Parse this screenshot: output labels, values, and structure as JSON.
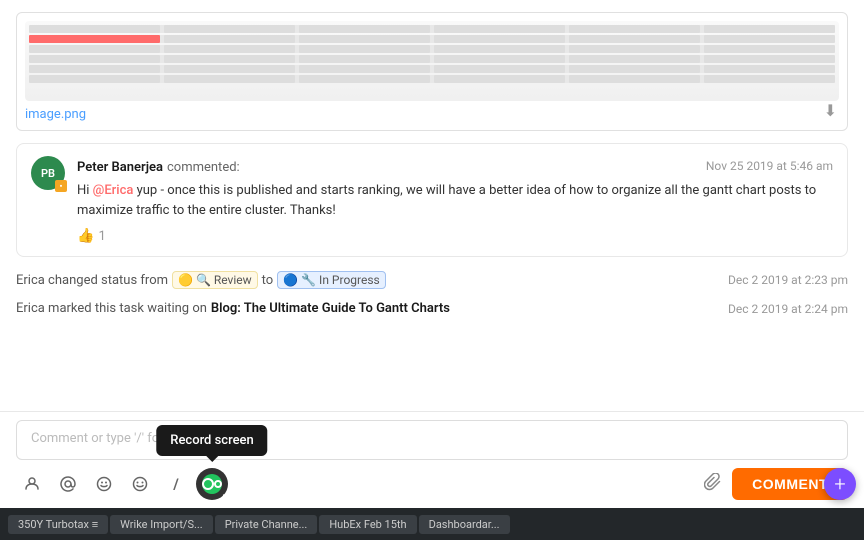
{
  "image": {
    "filename": "image.png",
    "download_label": "⬇"
  },
  "comment": {
    "author": "Peter Banerjea",
    "action": "commented:",
    "timestamp": "Nov 25 2019 at 5:46 am",
    "avatar_initials": "PB",
    "text_before_mention": "Hi ",
    "mention": "@Erica",
    "text_after_mention": " yup - once this is published and starts ranking, we will have a better idea of how to organize all the gantt chart posts to maximize traffic to the entire cluster. Thanks!",
    "likes": "1"
  },
  "activity": [
    {
      "text": "Erica changed status from",
      "from_status": "Review",
      "to_word": "to",
      "to_status": "In Progress",
      "timestamp": "Dec 2 2019 at 2:23 pm"
    },
    {
      "text": "Erica marked this task waiting on",
      "task_link": "Blog: The Ultimate Guide To Gantt Charts",
      "timestamp": "Dec 2 2019 at 2:24 pm"
    }
  ],
  "input": {
    "placeholder": "Comment or type '/' for commands"
  },
  "toolbar": {
    "icons": [
      {
        "name": "person-icon",
        "symbol": "👤"
      },
      {
        "name": "at-icon",
        "symbol": "@"
      },
      {
        "name": "emoji-smile-icon",
        "symbol": "😊"
      },
      {
        "name": "emoji-alt-icon",
        "symbol": "😀"
      },
      {
        "name": "slash-icon",
        "symbol": "/"
      },
      {
        "name": "record-icon",
        "symbol": "●"
      }
    ],
    "attach_icon": "📎",
    "comment_button": "COMMENT",
    "record_tooltip": "Record screen"
  },
  "taskbar": {
    "items": [
      "350Y Turbotax ≡",
      "Wrike Import/S...",
      "Private Channe...",
      "HubEx Feb 15th",
      "Dashboardar..."
    ]
  },
  "fab": {
    "label": "+"
  }
}
